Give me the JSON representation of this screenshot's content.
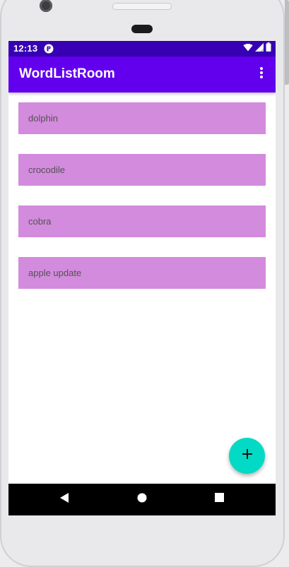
{
  "status_bar": {
    "time": "12:13",
    "background": "#3700b3",
    "icons": [
      "app-notification-icon",
      "wifi-icon",
      "signal-icon",
      "battery-icon"
    ]
  },
  "app_bar": {
    "title": "WordListRoom",
    "background": "#6200ee",
    "menu_icon": "more-vert-icon"
  },
  "words": [
    {
      "text": "dolphin"
    },
    {
      "text": "crocodile"
    },
    {
      "text": "cobra"
    },
    {
      "text": "apple update"
    }
  ],
  "item_color": "#d38bdd",
  "fab": {
    "icon": "plus-icon",
    "color": "#03dac5"
  },
  "navigation": {
    "buttons": [
      "back-icon",
      "home-icon",
      "recents-icon"
    ]
  }
}
